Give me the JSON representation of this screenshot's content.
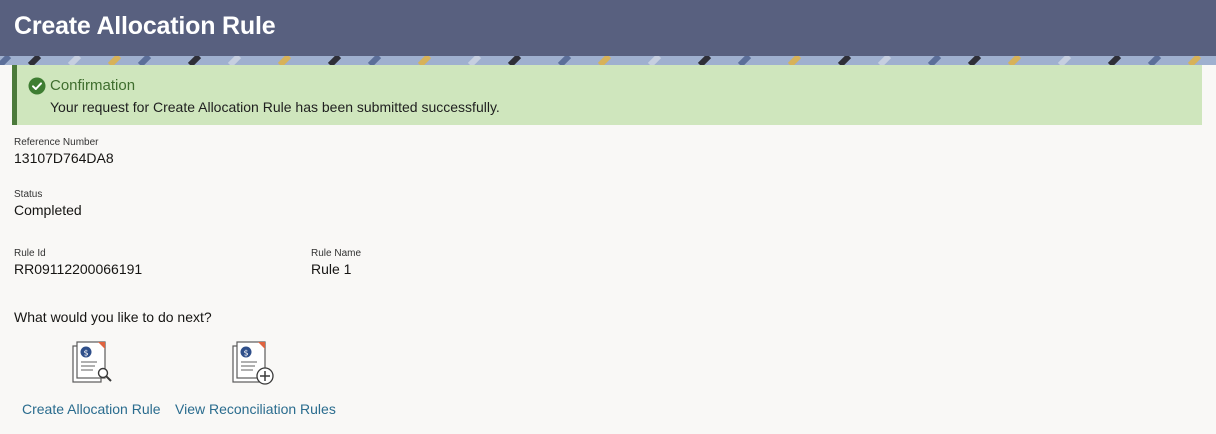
{
  "header": {
    "title": "Create Allocation Rule"
  },
  "confirmation": {
    "title": "Confirmation",
    "message": "Your request for Create Allocation Rule has been submitted successfully.",
    "icon": "check-circle-icon",
    "accent_color": "#4b7a3a",
    "background_color": "#cfe6bd"
  },
  "fields": {
    "reference_number": {
      "label": "Reference Number",
      "value": "13107D764DA8"
    },
    "status": {
      "label": "Status",
      "value": "Completed"
    },
    "rule_id": {
      "label": "Rule Id",
      "value": "RR09112200066191"
    },
    "rule_name": {
      "label": "Rule Name",
      "value": "Rule 1"
    }
  },
  "next": {
    "question": "What would you like to do next?",
    "actions": [
      {
        "label": "Create Allocation Rule",
        "icon": "document-search-icon"
      },
      {
        "label": "View Reconciliation Rules",
        "icon": "document-add-icon"
      }
    ]
  },
  "colors": {
    "header_bg": "#58607f",
    "link": "#2a6c8e"
  }
}
